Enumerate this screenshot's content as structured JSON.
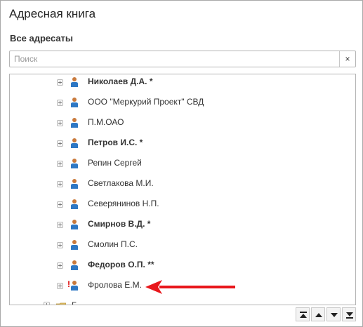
{
  "window": {
    "title": "Адресная книга"
  },
  "section_title": "Все адресаты",
  "search": {
    "placeholder": "Поиск",
    "value": "",
    "clear_label": "×"
  },
  "tree": {
    "items": [
      {
        "label": "Николаев Д.А. *",
        "bold": true,
        "icon": "person-icon"
      },
      {
        "label": "ООО \"Меркурий Проект\" СВД",
        "bold": false,
        "icon": "person-icon"
      },
      {
        "label": "П.М.ОАО",
        "bold": false,
        "icon": "person-icon"
      },
      {
        "label": "Петров И.С. *",
        "bold": true,
        "icon": "person-icon"
      },
      {
        "label": "Репин Сергей",
        "bold": false,
        "icon": "person-icon"
      },
      {
        "label": "Светлакова М.И.",
        "bold": false,
        "icon": "person-icon"
      },
      {
        "label": "Северянинов Н.П.",
        "bold": false,
        "icon": "person-icon"
      },
      {
        "label": "Смирнов В.Д. *",
        "bold": true,
        "icon": "person-icon"
      },
      {
        "label": "Смолин П.С.",
        "bold": false,
        "icon": "person-icon"
      },
      {
        "label": "Федоров О.П. **",
        "bold": true,
        "icon": "person-icon"
      },
      {
        "label": "Фролова Е.М.",
        "bold": false,
        "icon": "person-warning-icon",
        "warning": "!"
      }
    ],
    "partial_folder_label": "Б"
  },
  "navigation": {
    "buttons": [
      "move-first",
      "move-up",
      "move-down",
      "move-last"
    ]
  },
  "colors": {
    "annotation_arrow": "#e8161b",
    "accent_person": "#2f78c4"
  }
}
